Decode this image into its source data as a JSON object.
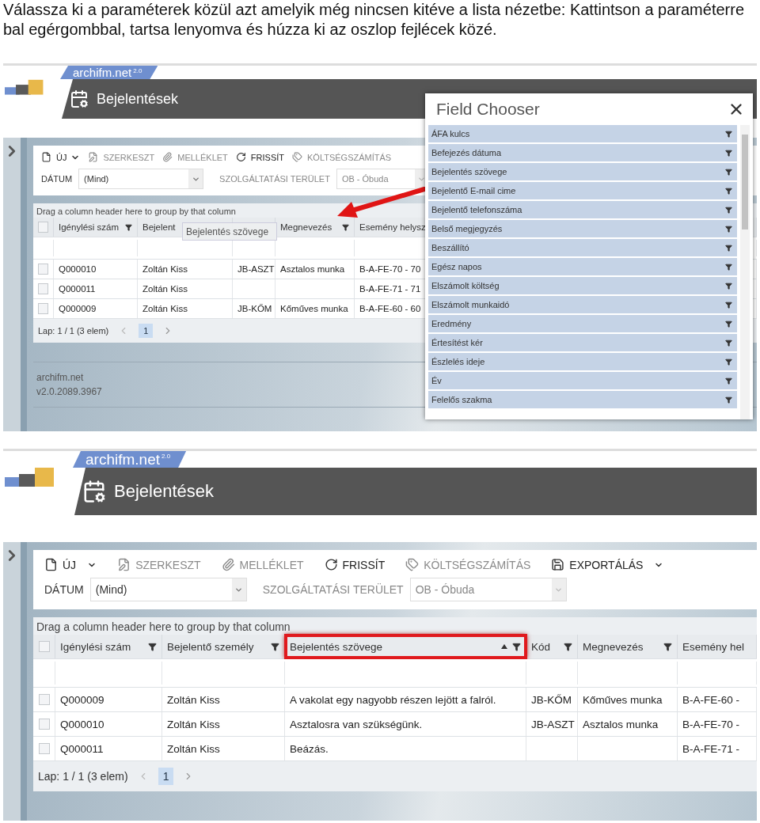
{
  "instruction": "Válassza ki a paraméterek közül azt amelyik még nincsen kitéve a lista nézetbe: Kattintson a paraméterre bal egérgombbal, tartsa lenyomva és húzza ki az oszlop fejlécek közé.",
  "screens": [
    {
      "logo": "archifm.net",
      "logo_version": "2.0",
      "page_title": "Bejelentések",
      "toolbar": [
        {
          "label": "ÚJ",
          "caret": true,
          "disabled": false
        },
        {
          "label": "SZERKESZT",
          "caret": false,
          "disabled": true
        },
        {
          "label": "MELLÉKLET",
          "caret": false,
          "disabled": true
        },
        {
          "label": "FRISSÍT",
          "caret": false,
          "disabled": false
        },
        {
          "label": "KÖLTSÉGSZÁMÍTÁS",
          "caret": false,
          "disabled": true
        }
      ],
      "filters": [
        {
          "label": "DÁTUM",
          "value": "(Mind)",
          "disabled": false
        },
        {
          "label": "SZOLGÁLTATÁSI TERÜLET",
          "value": "OB - Óbuda",
          "disabled": true
        }
      ],
      "group_hint": "Drag a column header here to group by that column",
      "header_checked": false,
      "columns": [
        {
          "label": "Igénylési szám",
          "filter": true
        },
        {
          "label": "Bejelent"
        },
        {},
        {
          "label": "Megnevezés",
          "filter": true
        },
        {
          "label": "Esemény helysz"
        }
      ],
      "rows": [
        {
          "checked": false,
          "cells": [
            "Q000010",
            "Zoltán Kiss",
            "JB-ASZT",
            "Asztalos munka",
            "B-A-FE-70 - 70"
          ]
        },
        {
          "checked": false,
          "cells": [
            "Q000011",
            "Zoltán Kiss",
            null,
            null,
            "B-A-FE-71 - 71"
          ]
        },
        {
          "checked": false,
          "cells": [
            "Q000009",
            "Zoltán Kiss",
            "JB-KŐM",
            "Kőműves munka",
            "B-A-FE-60 - 60"
          ]
        }
      ],
      "pager": {
        "summary": "Lap: 1 / 1 (3 elem)",
        "pages": [
          {
            "label": "1",
            "selected": true
          }
        ]
      },
      "footer": [
        "archifm.net",
        "v2.0.2089.3967"
      ],
      "drag_ghost": "Bejelentés szövege",
      "annotation": {
        "kind": "arrow"
      },
      "field_chooser": {
        "title": "Field Chooser",
        "items": [
          "ÁFA kulcs",
          "Befejezés dátuma",
          "Bejelentés szövege",
          "Bejelentő E-mail cime",
          "Bejelentő telefonszáma",
          "Belső megjegyzés",
          "Beszállító",
          "Egész napos",
          "Elszámolt költség",
          "Elszámolt munkaidó",
          "Eredmény",
          "Értesítést kér",
          "Észlelés ideje",
          "Év",
          "Felelős szakma"
        ]
      }
    },
    {
      "logo": "archifm.net",
      "logo_version": "2.0",
      "page_title": "Bejelentések",
      "toolbar": [
        {
          "label": "ÚJ",
          "caret": true,
          "disabled": false
        },
        {
          "label": "SZERKESZT",
          "caret": false,
          "disabled": true
        },
        {
          "label": "MELLÉKLET",
          "caret": false,
          "disabled": true
        },
        {
          "label": "FRISSÍT",
          "caret": false,
          "disabled": false
        },
        {
          "label": "KÖLTSÉGSZÁMÍTÁS",
          "caret": false,
          "disabled": true
        },
        {
          "label": "EXPORTÁLÁS",
          "caret": true,
          "disabled": false
        }
      ],
      "filters": [
        {
          "label": "DÁTUM",
          "value": "(Mind)",
          "disabled": false
        },
        {
          "label": "SZOLGÁLTATÁSI TERÜLET",
          "value": "OB - Óbuda",
          "disabled": true
        }
      ],
      "group_hint": "Drag a column header here to group by that column",
      "header_checked": false,
      "columns": [
        {
          "label": "Igénylési szám",
          "filter": true
        },
        {
          "label": "Bejelentő személy",
          "filter": true
        },
        {
          "label": "Bejelentés szövege",
          "filter": true,
          "sorted_ascending": true,
          "highlighted": true
        },
        {
          "label": "Kód",
          "filter": true
        },
        {
          "label": "Megnevezés",
          "filter": true
        },
        {
          "label": "Esemény hel"
        }
      ],
      "rows": [
        {
          "checked": false,
          "cells": [
            "Q000009",
            "Zoltán Kiss",
            "A vakolat egy nagyobb részen lejött a falról.",
            "JB-KŐM",
            "Kőműves munka",
            "B-A-FE-60 -"
          ]
        },
        {
          "checked": false,
          "cells": [
            "Q000010",
            "Zoltán Kiss",
            "Asztalosra van szükségünk.",
            "JB-ASZT",
            "Asztalos munka",
            "B-A-FE-70 -"
          ]
        },
        {
          "checked": false,
          "cells": [
            "Q000011",
            "Zoltán Kiss",
            "Beázás.",
            null,
            null,
            "B-A-FE-71 -"
          ]
        }
      ],
      "pager": {
        "summary": "Lap: 1 / 1 (3 elem)",
        "pages": [
          {
            "label": "1",
            "selected": true
          }
        ]
      }
    }
  ]
}
